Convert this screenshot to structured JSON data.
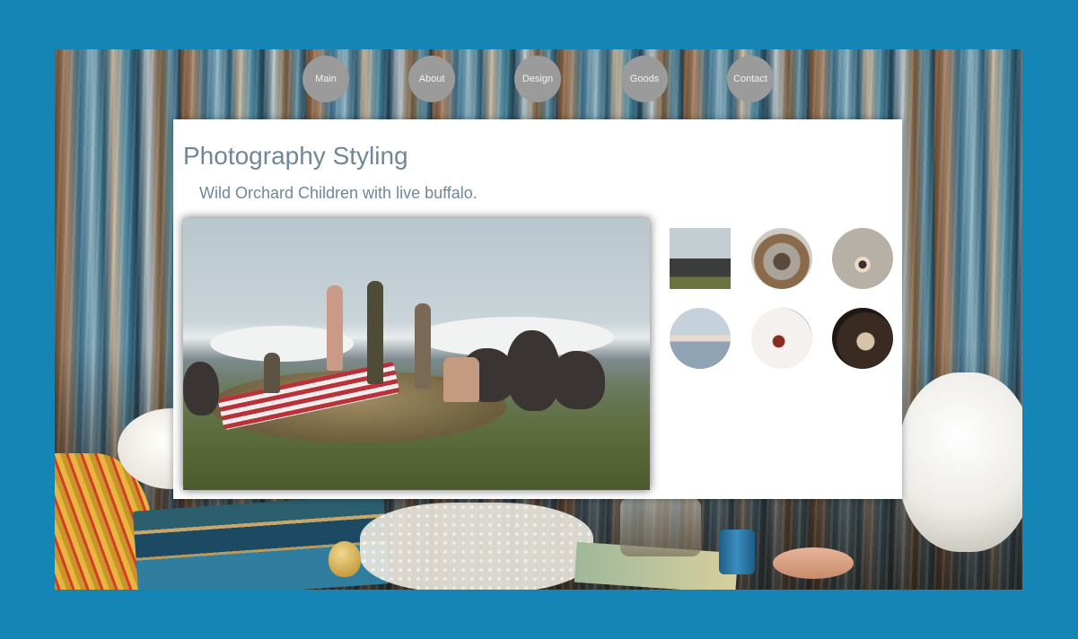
{
  "nav": {
    "items": [
      {
        "label": "Main"
      },
      {
        "label": "About"
      },
      {
        "label": "Design"
      },
      {
        "label": "Goods"
      },
      {
        "label": "Contact"
      }
    ]
  },
  "content": {
    "title": "Photography Styling",
    "caption": "Wild Orchard Children with live buffalo."
  },
  "colors": {
    "page_background": "#1585b5",
    "nav_circle": "#9b9b9b",
    "heading_text": "#6f8799",
    "panel": "#ffffff"
  }
}
